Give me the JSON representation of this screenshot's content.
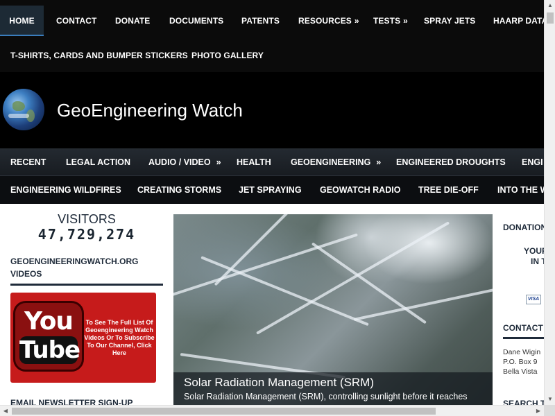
{
  "top_nav": {
    "row1": [
      {
        "label": "HOME",
        "active": true
      },
      {
        "label": "CONTACT"
      },
      {
        "label": "DONATE"
      },
      {
        "label": "DOCUMENTS"
      },
      {
        "label": "PATENTS"
      },
      {
        "label": "RESOURCES",
        "chevron": "»"
      },
      {
        "label": "TESTS",
        "chevron": "»"
      },
      {
        "label": "SPRAY JETS"
      },
      {
        "label": "HAARP DATA"
      }
    ],
    "row2": [
      {
        "label": "T-SHIRTS, CARDS AND BUMPER STICKERS"
      },
      {
        "label": "PHOTO GALLERY"
      }
    ]
  },
  "header": {
    "site_title": "GeoEngineering Watch",
    "logo_icon": "globe-icon"
  },
  "main_nav": {
    "row1": [
      {
        "label": "RECENT"
      },
      {
        "label": "LEGAL ACTION"
      },
      {
        "label": "AUDIO / VIDEO",
        "chevron": "»"
      },
      {
        "label": "HEALTH"
      },
      {
        "label": "GEOENGINEERING",
        "chevron": "»"
      },
      {
        "label": "ENGINEERED DROUGHTS"
      },
      {
        "label": "ENGI"
      }
    ],
    "row2": [
      {
        "label": "ENGINEERING WILDFIRES"
      },
      {
        "label": "CREATING STORMS"
      },
      {
        "label": "JET SPRAYING"
      },
      {
        "label": "GEOWATCH RADIO"
      },
      {
        "label": "TREE DIE-OFF"
      },
      {
        "label": "INTO THE W"
      }
    ]
  },
  "sidebar_left": {
    "visitors_label": "VISITORS",
    "visitors_count": "47,729,274",
    "videos_heading": "GEOENGINEERINGWATCH.ORG VIDEOS",
    "youtube": {
      "you": "You",
      "tube": "Tube",
      "text": "To See The Full List Of Geoengineering Watch Videos Or To Subscribe To Our Channel, Click Here"
    },
    "newsletter_heading": "EMAIL NEWSLETTER SIGN-UP"
  },
  "featured": {
    "title": "Solar Radiation Management (SRM)",
    "text": "Solar Radiation Management (SRM), controlling sunlight before it reaches"
  },
  "sidebar_right": {
    "donations_heading": "DONATIONS",
    "your_line": "YOUR",
    "in_line": "IN T",
    "visa_label": "VISA",
    "contact_heading": "CONTACT",
    "address": [
      "Dane Wigin",
      "P.O. Box 9",
      "Bella Vista"
    ],
    "search_heading": "SEARCH T"
  },
  "colors": {
    "nav_bg": "#0b0b0b",
    "header_bg": "#000000",
    "active_underline": "#3a7dbd",
    "heading_text": "#1f2b3a",
    "youtube_red": "#c61b1b"
  }
}
